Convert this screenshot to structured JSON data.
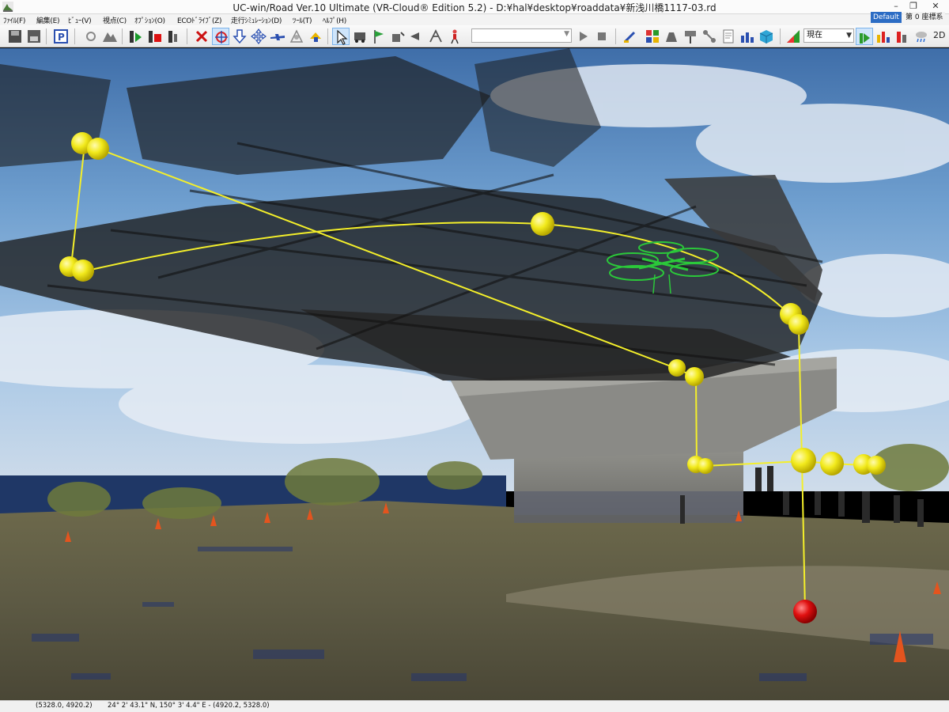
{
  "window": {
    "title": "UC-win/Road Ver.10 Ultimate (VR-Cloud® Edition 5.2) - D:¥hal¥desktop¥roaddata¥新浅川橋1117-03.rd",
    "minimize_glyph": "–",
    "maximize_glyph": "❐",
    "close_glyph": "✕",
    "mode_label": "Default",
    "coordinate_label": "第 0 座標系"
  },
  "menu": [
    {
      "label": "ﾌｧｲﾙ(F)"
    },
    {
      "label": "編集(E)"
    },
    {
      "label": "ﾋﾞｭｰ(V)"
    },
    {
      "label": "視点(C)"
    },
    {
      "label": "ｵﾌﾟｼｮﾝ(O)"
    },
    {
      "label": "ECOﾄﾞﾗｲﾌﾞ(Z)"
    },
    {
      "label": "走行ｼﾐｭﾚｰｼｮﾝ(D)"
    },
    {
      "label": "ﾂｰﾙ(T)"
    },
    {
      "label": "ﾍﾙﾌﾟ(H)"
    }
  ],
  "toolbar": {
    "route_value": "",
    "time_value": "現在",
    "view_2d_label": "2D",
    "icons": [
      "save-icon",
      "save-as-icon",
      "parking-icon",
      "camera-move-icon",
      "terrain-icon",
      "play-sim-icon",
      "record-sim-icon",
      "stop-sim-icon",
      "edit-x-icon",
      "rotate-icon",
      "down-arrow-icon",
      "move-icon",
      "aircraft-icon",
      "flight-path-icon",
      "drone-icon",
      "select-cursor-icon",
      "vehicle-icon",
      "flag-icon",
      "stopwatch-icon",
      "pointer-icon",
      "crane-icon",
      "walker-icon",
      "play-icon",
      "stop-icon",
      "brush-icon",
      "grid-icon",
      "weight-icon",
      "sign-icon",
      "network-icon",
      "document-icon",
      "cube-icon",
      "graph-icon",
      "signal-icon",
      "signal-alt-icon",
      "signal-red-icon",
      "weather-icon"
    ]
  },
  "status": {
    "position": "(5328.0, 4920.2)",
    "geo": "24° 2' 43.1\" N, 150° 3' 4.4\" E - (4920.2, 5328.0)"
  },
  "scene": {
    "path_color": "#f4ef2a",
    "waypoint_color": "#f2ea1c",
    "end_marker_color": "#e01010",
    "drone_color": "#2bc83a"
  }
}
